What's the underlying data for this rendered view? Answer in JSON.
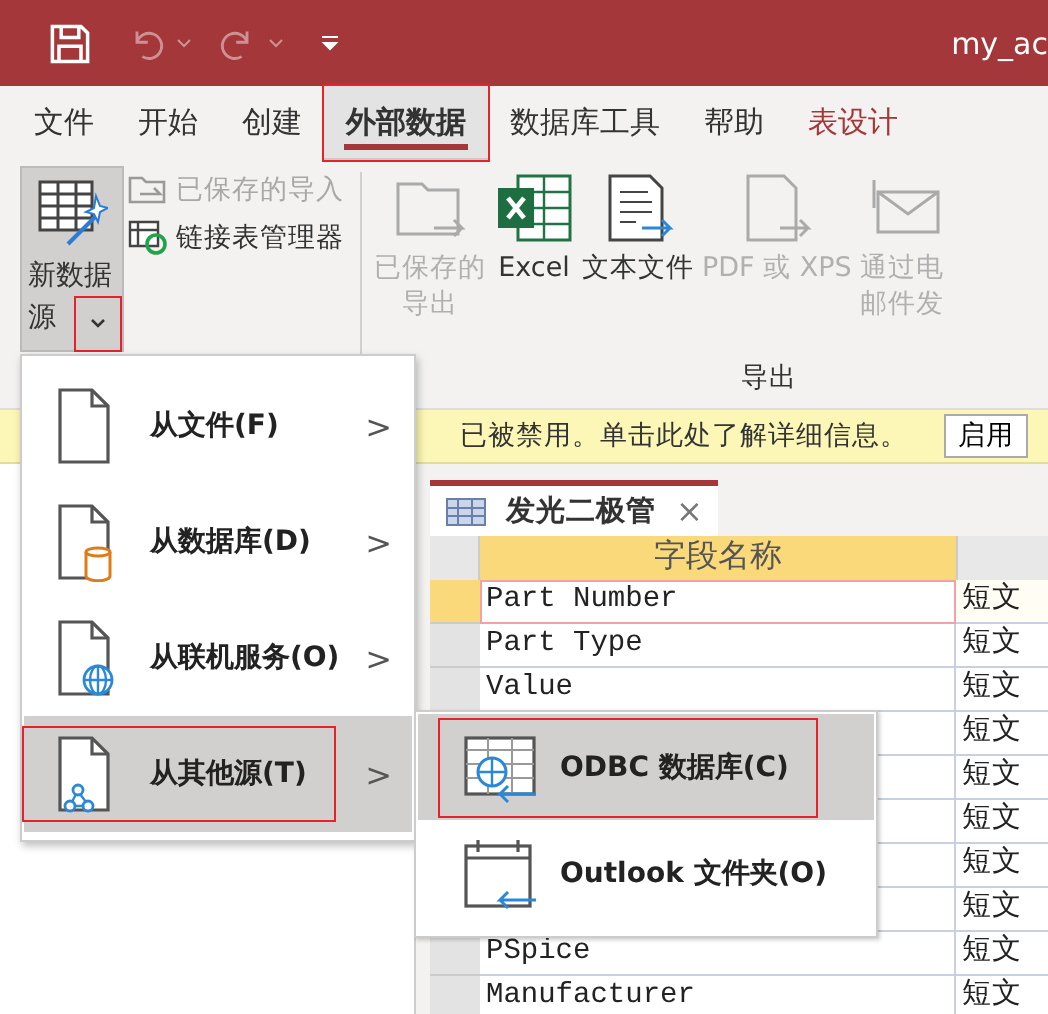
{
  "title_bar": {
    "title": "my_ac",
    "undo_disabled": true,
    "redo_disabled": true
  },
  "tabs": [
    {
      "label": "文件",
      "selected": false,
      "annotated": false,
      "accent": false
    },
    {
      "label": "开始",
      "selected": false,
      "annotated": false,
      "accent": false
    },
    {
      "label": "创建",
      "selected": false,
      "annotated": false,
      "accent": false
    },
    {
      "label": "外部数据",
      "selected": true,
      "annotated": true,
      "accent": false
    },
    {
      "label": "数据库工具",
      "selected": false,
      "annotated": false,
      "accent": false
    },
    {
      "label": "帮助",
      "selected": false,
      "annotated": false,
      "accent": false
    },
    {
      "label": "表设计",
      "selected": false,
      "annotated": false,
      "accent": true
    }
  ],
  "ribbon": {
    "new_source": {
      "label": "新数据源",
      "pressed": true,
      "arrow_annotated": true
    },
    "small_buttons": [
      {
        "kind": "saved-import",
        "label": "已保存的导入",
        "disabled": true
      },
      {
        "kind": "linked-table",
        "label": "链接表管理器",
        "disabled": false
      }
    ],
    "export_buttons": [
      {
        "kind": "saved-export",
        "lines": [
          "已保存的",
          "导出"
        ],
        "disabled": true
      },
      {
        "kind": "excel",
        "lines": [
          "Excel"
        ],
        "disabled": false
      },
      {
        "kind": "text",
        "lines": [
          "文本文件"
        ],
        "disabled": false
      },
      {
        "kind": "pdf",
        "lines": [
          "PDF 或 XPS"
        ],
        "disabled": true
      },
      {
        "kind": "email",
        "lines": [
          "通过电",
          "邮件发"
        ],
        "disabled": true
      }
    ],
    "export_group": "导出"
  },
  "message_bar": {
    "text": "已被禁用。单击此处了解详细信息。",
    "button": "启用"
  },
  "document": {
    "tab": "发光二极管",
    "close": "×",
    "header": "字段名称",
    "rows": [
      {
        "name": "Part Number",
        "type": "短文",
        "current": true
      },
      {
        "name": "Part Type",
        "type": "短文",
        "current": false
      },
      {
        "name": "Value",
        "type": "短文",
        "current": false
      },
      {
        "type": "短文",
        "current": false
      },
      {
        "type": "短文",
        "current": false
      },
      {
        "type": "短文",
        "current": false
      },
      {
        "type": "短文",
        "current": false
      },
      {
        "type": "短文",
        "current": false
      },
      {
        "name": "PSpice",
        "type": "短文",
        "current": false
      },
      {
        "name": "Manufacturer",
        "type": "短文",
        "current": false
      }
    ]
  },
  "menu": {
    "items": [
      {
        "kind": "file",
        "label": "从文件(F)",
        "arrow": ">",
        "selected": false,
        "annotated": false
      },
      {
        "kind": "database",
        "label": "从数据库(D)",
        "arrow": ">",
        "selected": false,
        "annotated": false
      },
      {
        "kind": "online",
        "label": "从联机服务(O)",
        "arrow": ">",
        "selected": false,
        "annotated": false
      },
      {
        "kind": "other",
        "label": "从其他源(T)",
        "arrow": ">",
        "selected": true,
        "annotated": true
      }
    ]
  },
  "submenu": {
    "items": [
      {
        "kind": "odbc",
        "label": "ODBC 数据库(C)",
        "selected": true,
        "annotated": true
      },
      {
        "kind": "outlook",
        "label": "Outlook 文件夹(O)",
        "selected": false,
        "annotated": false
      }
    ]
  }
}
